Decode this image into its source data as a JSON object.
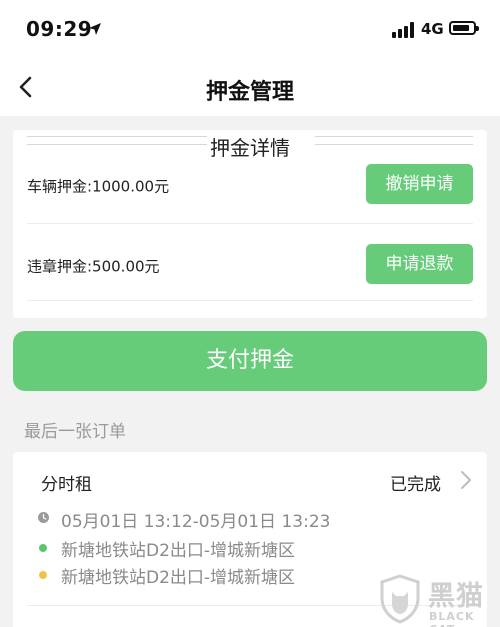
{
  "status_bar": {
    "time": "09:29",
    "network": "4G",
    "icons": [
      "location-arrow-icon",
      "signal-icon",
      "battery-icon"
    ]
  },
  "nav": {
    "title": "押金管理",
    "back_icon": "chevron-left-icon"
  },
  "deposit_card": {
    "title": "押金详情",
    "rows": [
      {
        "label": "车辆押金:1000.00元",
        "button": "撤销申请"
      },
      {
        "label": "违章押金:500.00元",
        "button": "申请退款"
      }
    ]
  },
  "pay_button": "支付押金",
  "last_order": {
    "section_label": "最后一张订单",
    "type": "分时租",
    "status": "已完成",
    "time_range": "05月01日 13:12-05月01日 13:23",
    "start_location": "新塘地铁站D2出口-增城新塘区",
    "end_location": "新塘地铁站D2出口-增城新塘区"
  },
  "colors": {
    "accent_green": "#66cc7a",
    "start_dot": "#5cc46e",
    "end_dot": "#f0c24a",
    "background": "#f2f2f2"
  },
  "watermark": {
    "text_cn": "黑猫",
    "text_en": "BLACK CAT"
  }
}
